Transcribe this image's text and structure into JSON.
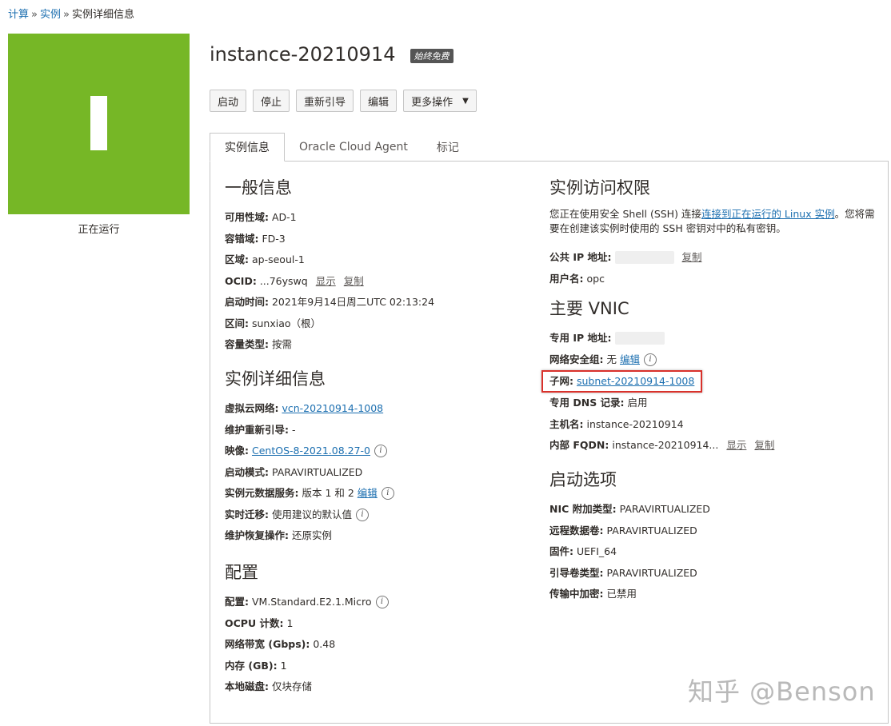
{
  "breadcrumb": {
    "items": [
      "计算",
      "实例"
    ],
    "current": "实例详细信息",
    "sep": "»"
  },
  "status": {
    "letter": "I",
    "text": "正在运行",
    "color": "#76b726"
  },
  "header": {
    "title": "instance-20210914",
    "badge": "始终免费"
  },
  "actions": {
    "start": "启动",
    "stop": "停止",
    "reboot": "重新引导",
    "edit": "编辑",
    "more": "更多操作"
  },
  "tabs": [
    "实例信息",
    "Oracle Cloud Agent",
    "标记"
  ],
  "general": {
    "title": "一般信息",
    "ad_k": "可用性域:",
    "ad_v": "AD-1",
    "fd_k": "容错域:",
    "fd_v": "FD-3",
    "region_k": "区域:",
    "region_v": "ap-seoul-1",
    "ocid_k": "OCID:",
    "ocid_v": "...76yswq",
    "ocid_show": "显示",
    "ocid_copy": "复制",
    "launched_k": "启动时间:",
    "launched_v": "2021年9月14日周二UTC 02:13:24",
    "compartment_k": "区间:",
    "compartment_v": "sunxiao（根）",
    "capacity_k": "容量类型:",
    "capacity_v": "按需"
  },
  "details": {
    "title": "实例详细信息",
    "vcn_k": "虚拟云网络:",
    "vcn_v": "vcn-20210914-1008",
    "maint_reboot_k": "维护重新引导:",
    "maint_reboot_v": "-",
    "image_k": "映像:",
    "image_v": "CentOS-8-2021.08.27-0",
    "launch_mode_k": "启动模式:",
    "launch_mode_v": "PARAVIRTUALIZED",
    "imds_k": "实例元数据服务:",
    "imds_v": "版本 1 和 2",
    "imds_edit": "编辑",
    "live_migration_k": "实时迁移:",
    "live_migration_v": "使用建议的默认值",
    "recovery_k": "维护恢复操作:",
    "recovery_v": "还原实例"
  },
  "config": {
    "title": "配置",
    "shape_k": "配置:",
    "shape_v": "VM.Standard.E2.1.Micro",
    "ocpu_k": "OCPU 计数:",
    "ocpu_v": "1",
    "bandwidth_k": "网络带宽 (Gbps):",
    "bandwidth_v": "0.48",
    "memory_k": "内存 (GB):",
    "memory_v": "1",
    "disk_k": "本地磁盘:",
    "disk_v": "仅块存储"
  },
  "access": {
    "title": "实例访问权限",
    "desc_pre": "您正在使用安全 Shell (SSH) 连接",
    "desc_link": "连接到正在运行的 Linux 实例",
    "desc_post": "。您将需要在创建该实例时使用的 SSH 密钥对中的私有密钥。",
    "public_ip_k": "公共 IP 地址:",
    "copy": "复制",
    "username_k": "用户名:",
    "username_v": "opc"
  },
  "vnic": {
    "title": "主要 VNIC",
    "private_ip_k": "专用 IP 地址:",
    "nsg_k": "网络安全组:",
    "nsg_v": "无",
    "nsg_edit": "编辑",
    "subnet_k": "子网:",
    "subnet_v": "subnet-20210914-1008",
    "dns_k": "专用 DNS 记录:",
    "dns_v": "启用",
    "hostname_k": "主机名:",
    "hostname_v": "instance-20210914",
    "fqdn_k": "内部 FQDN:",
    "fqdn_v": "instance-20210914...",
    "fqdn_show": "显示",
    "fqdn_copy": "复制"
  },
  "launch_options": {
    "title": "启动选项",
    "nic_k": "NIC 附加类型:",
    "nic_v": "PARAVIRTUALIZED",
    "remote_k": "远程数据卷:",
    "remote_v": "PARAVIRTUALIZED",
    "firmware_k": "固件:",
    "firmware_v": "UEFI_64",
    "boot_k": "引导卷类型:",
    "boot_v": "PARAVIRTUALIZED",
    "encrypt_k": "传输中加密:",
    "encrypt_v": "已禁用"
  },
  "watermark": "知乎 @Benson"
}
